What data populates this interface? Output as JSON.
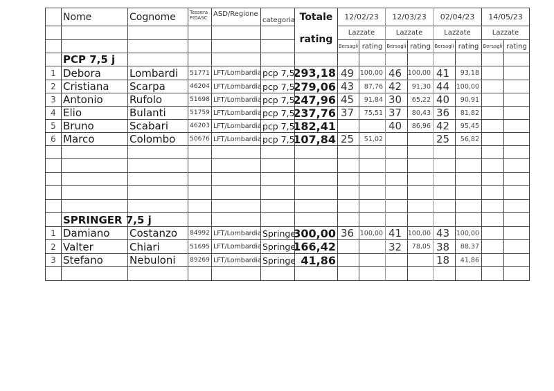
{
  "header": {
    "nome": "Nome",
    "cognome": "Cognome",
    "tessera_line1": "Tessera",
    "tessera_line2": "FIDASC",
    "asd": "ASD/Regione",
    "categoria": "categoria",
    "totale": "Totale",
    "rating": "rating",
    "events": [
      {
        "date": "12/02/23",
        "location": "Lazzate",
        "col1": "Bersagli",
        "col2": "rating"
      },
      {
        "date": "12/03/23",
        "location": "Lazzate",
        "col1": "Bersagli",
        "col2": "rating"
      },
      {
        "date": "02/04/23",
        "location": "Lazzate",
        "col1": "Bersagli",
        "col2": "rating"
      },
      {
        "date": "14/05/23",
        "location": "Lazzate",
        "col1": "Bersagli",
        "col2": "rating"
      }
    ]
  },
  "sections": [
    {
      "title": "PCP 7,5 j",
      "rows": [
        {
          "n": "1",
          "nome": "Debora",
          "cognome": "Lombardi",
          "tessera": "51771",
          "asd": "LFT/Lombardia",
          "cat": "pcp 7,5",
          "totale": "293,18",
          "scores": [
            [
              "49",
              "100,00"
            ],
            [
              "46",
              "100,00"
            ],
            [
              "41",
              "93,18"
            ],
            [
              "",
              ""
            ]
          ]
        },
        {
          "n": "2",
          "nome": "Cristiana",
          "cognome": "Scarpa",
          "tessera": "46204",
          "asd": "LFT/Lombardia",
          "cat": "pcp 7,5",
          "totale": "279,06",
          "scores": [
            [
              "43",
              "87,76"
            ],
            [
              "42",
              "91,30"
            ],
            [
              "44",
              "100,00"
            ],
            [
              "",
              ""
            ]
          ]
        },
        {
          "n": "3",
          "nome": "Antonio",
          "cognome": "Rufolo",
          "tessera": "51698",
          "asd": "LFT/Lombardia",
          "cat": "pcp 7,5",
          "totale": "247,96",
          "scores": [
            [
              "45",
              "91,84"
            ],
            [
              "30",
              "65,22"
            ],
            [
              "40",
              "90,91"
            ],
            [
              "",
              ""
            ]
          ]
        },
        {
          "n": "4",
          "nome": "Elio",
          "cognome": "Bulanti",
          "tessera": "51759",
          "asd": "LFT/Lombardia",
          "cat": "pcp 7,5",
          "totale": "237,76",
          "scores": [
            [
              "37",
              "75,51"
            ],
            [
              "37",
              "80,43"
            ],
            [
              "36",
              "81,82"
            ],
            [
              "",
              ""
            ]
          ]
        },
        {
          "n": "5",
          "nome": "Bruno",
          "cognome": "Scabari",
          "tessera": "46203",
          "asd": "LFT/Lombardia",
          "cat": "pcp 7,5",
          "totale": "182,41",
          "scores": [
            [
              "",
              ""
            ],
            [
              "40",
              "86,96"
            ],
            [
              "42",
              "95,45"
            ],
            [
              "",
              ""
            ]
          ]
        },
        {
          "n": "6",
          "nome": "Marco",
          "cognome": "Colombo",
          "tessera": "50676",
          "asd": "LFT/Lombardia",
          "cat": "pcp 7,5",
          "totale": "107,84",
          "scores": [
            [
              "25",
              "51,02"
            ],
            [
              "",
              ""
            ],
            [
              "25",
              "56,82"
            ],
            [
              "",
              ""
            ]
          ]
        }
      ]
    },
    {
      "title": "SPRINGER 7,5 j",
      "rows": [
        {
          "n": "1",
          "nome": "Damiano",
          "cognome": "Costanzo",
          "tessera": "84992",
          "asd": "LFT/Lombardia",
          "cat": "Springer",
          "totale": "300,00",
          "scores": [
            [
              "36",
              "100,00"
            ],
            [
              "41",
              "100,00"
            ],
            [
              "43",
              "100,00"
            ],
            [
              "",
              ""
            ]
          ]
        },
        {
          "n": "2",
          "nome": "Valter",
          "cognome": "Chiari",
          "tessera": "51695",
          "asd": "LFT/Lombardia",
          "cat": "Springer",
          "totale": "166,42",
          "scores": [
            [
              "",
              ""
            ],
            [
              "32",
              "78,05"
            ],
            [
              "38",
              "88,37"
            ],
            [
              "",
              ""
            ]
          ]
        },
        {
          "n": "3",
          "nome": "Stefano",
          "cognome": "Nebuloni",
          "tessera": "89269",
          "asd": "LFT/Lombardia",
          "cat": "Springer",
          "totale": "41,86",
          "scores": [
            [
              "",
              ""
            ],
            [
              "",
              ""
            ],
            [
              "18",
              "41,86"
            ],
            [
              "",
              ""
            ]
          ]
        }
      ]
    }
  ]
}
